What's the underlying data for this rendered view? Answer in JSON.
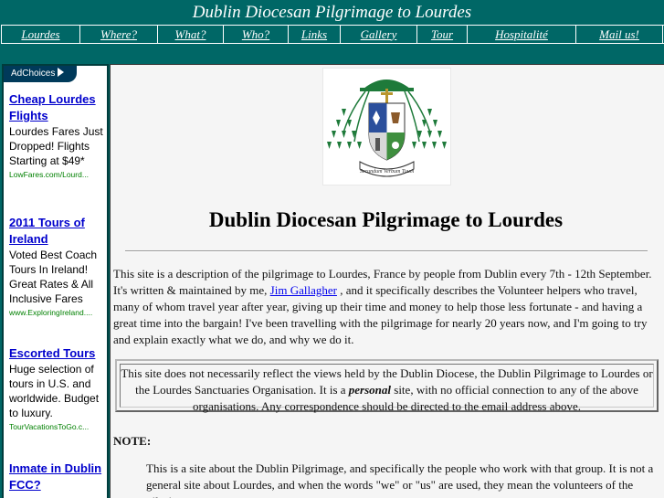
{
  "header": {
    "title": "Dublin Diocesan Pilgrimage to Lourdes"
  },
  "nav": {
    "items": [
      {
        "label": "Lourdes"
      },
      {
        "label": "Where?"
      },
      {
        "label": "What?"
      },
      {
        "label": "Who?"
      },
      {
        "label": "Links"
      },
      {
        "label": "Gallery"
      },
      {
        "label": "Tour"
      },
      {
        "label": "Hospitalité"
      },
      {
        "label": "Mail us!"
      }
    ]
  },
  "sidebar": {
    "adchoices_label": "AdChoices",
    "ads": [
      {
        "title": "Cheap Lourdes Flights",
        "text": "Lourdes Fares Just Dropped! Flights Starting at $49*",
        "url": "LowFares.com/Lourd..."
      },
      {
        "title": "2011 Tours of Ireland",
        "text": "Voted Best Coach Tours In Ireland! Great Rates & All Inclusive Fares",
        "url": "www.ExploringIreland...."
      },
      {
        "title": "Escorted Tours",
        "text": "Huge selection of tours in U.S. and worldwide. Budget to luxury.",
        "url": "TourVacationsToGo.c..."
      },
      {
        "title": "Inmate in Dublin FCC?",
        "text": "",
        "url": ""
      }
    ]
  },
  "main": {
    "crest": {
      "motto": "Secundum Verbum Tuum"
    },
    "title": "Dublin Diocesan Pilgrimage to Lourdes",
    "intro": {
      "before_link": "This site is a description of the pilgrimage to Lourdes, France by people from Dublin every 7th - 12th September. It's written & maintained by me, ",
      "link": "Jim Gallagher",
      "after_link": " , and it specifically describes the Volunteer helpers who travel, many of whom travel year after year, giving up their time and money to help those less fortunate - and having a great time into the bargain! I've been travelling with the pilgrimage for nearly 20 years now, and I'm going to try and explain exactly what we do, and why we do it."
    },
    "disclaimer": {
      "before": "This site does not necessarily reflect the views held by the Dublin Diocese, the Dublin Pilgrimage to Lourdes or the Lourdes Sanctuaries Organisation. It is a ",
      "emphasis": "personal",
      "after": " site, with no official connection to any of the above organisations. Any correspondence should be directed to the email address above."
    },
    "note_label": "NOTE:",
    "note_text": "This is a site about the Dublin Pilgrimage, and specifically the people who work with that group. It is not a general site about Lourdes, and when the words \"we\" or \"us\" are used, they mean the volunteers of the pilgrimage"
  },
  "colors": {
    "background": "#006766",
    "main_bg": "#f5f5f5",
    "ad_title": "#0000cc",
    "ad_url": "#008000",
    "adchoices_bg": "#003a5a"
  }
}
